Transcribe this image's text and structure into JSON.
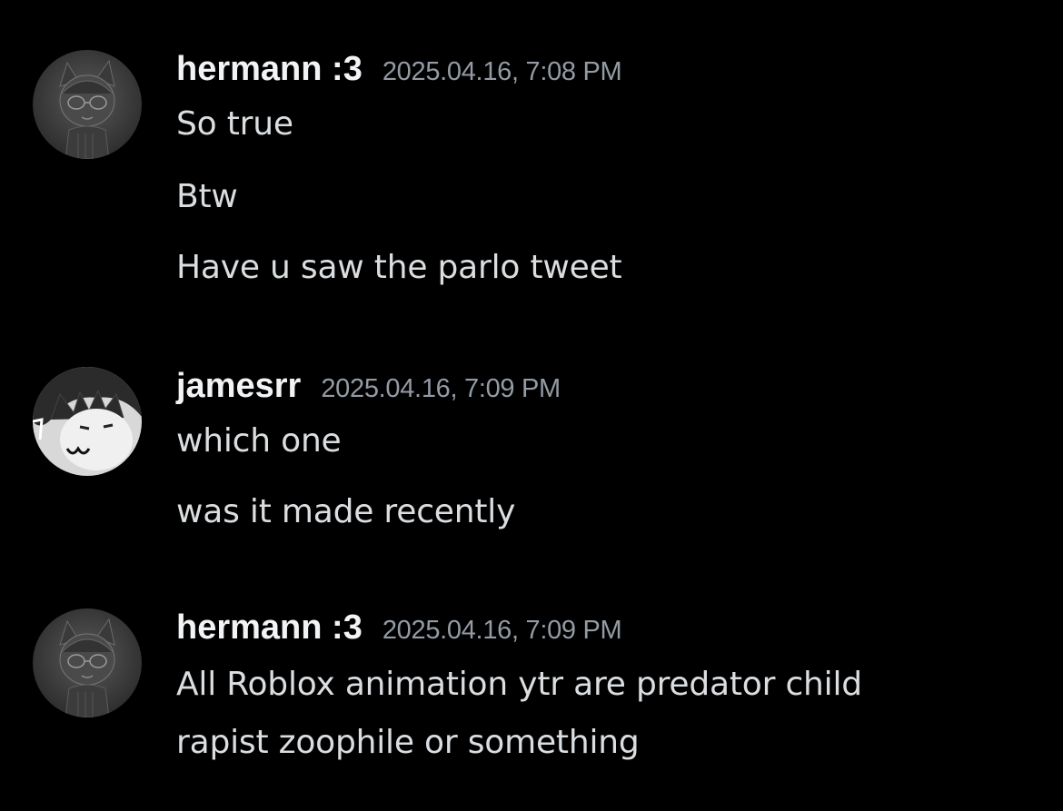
{
  "messages": [
    {
      "username": "hermann :3",
      "timestamp": "2025.04.16, 7:08 PM",
      "avatar_icon": "grayscale-anime-avatar-icon",
      "lines": [
        "So true",
        "Btw",
        "Have u saw the parlo tweet"
      ]
    },
    {
      "username": "jamesrr",
      "timestamp": "2025.04.16, 7:09 PM",
      "avatar_icon": "roblox-character-avatar-icon",
      "lines": [
        "which one",
        "was it made recently"
      ]
    },
    {
      "username": "hermann :3",
      "timestamp": "2025.04.16, 7:09 PM",
      "avatar_icon": "grayscale-anime-avatar-icon",
      "lines": [
        "All Roblox animation ytr are predator child",
        "rapist zoophile or something"
      ]
    }
  ],
  "colors": {
    "background": "#000000",
    "username": "#f2f3f5",
    "timestamp": "#949ba4",
    "message_text": "#dbdee1"
  }
}
